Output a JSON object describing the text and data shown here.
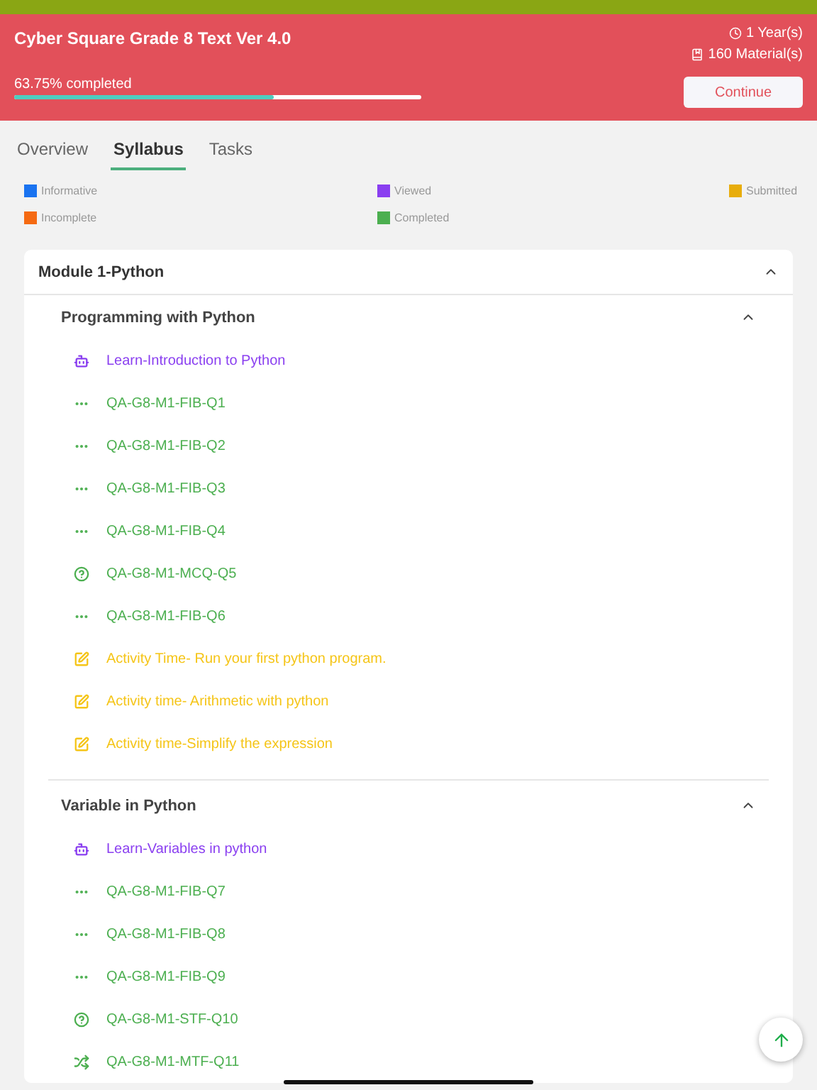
{
  "course": {
    "title": "Cyber Square Grade 8 Text Ver 4.0",
    "duration": "1 Year(s)",
    "materials": "160 Material(s)",
    "progress_text": "63.75% completed",
    "level": 0.6375,
    "continue_button": "Continue"
  },
  "tabs": [
    {
      "label": "Overview",
      "selected": false
    },
    {
      "label": "Syllabus",
      "selected": true
    },
    {
      "label": "Tasks",
      "selected": false
    }
  ],
  "legend": [
    {
      "label": "Informative",
      "color": "#1a73f0"
    },
    {
      "label": "Viewed",
      "color": "#8a3ff0"
    },
    {
      "label": "Submitted",
      "color": "#e8ad0c"
    },
    {
      "label": "Incomplete",
      "color": "#f56a12"
    },
    {
      "label": "Completed",
      "color": "#4caf50"
    }
  ],
  "module": {
    "title": "Module 1-Python",
    "expanded": true,
    "sections": [
      {
        "title": "Programming with Python",
        "expanded": true,
        "items": [
          {
            "kind": "learn",
            "label": "Learn-Introduction to Python",
            "color": "#8a3ff0"
          },
          {
            "kind": "fib",
            "label": "QA-G8-M1-FIB-Q1",
            "color": "#4caf50"
          },
          {
            "kind": "fib",
            "label": "QA-G8-M1-FIB-Q2",
            "color": "#4caf50"
          },
          {
            "kind": "fib",
            "label": "QA-G8-M1-FIB-Q3",
            "color": "#4caf50"
          },
          {
            "kind": "fib",
            "label": "QA-G8-M1-FIB-Q4",
            "color": "#4caf50"
          },
          {
            "kind": "question",
            "label": "QA-G8-M1-MCQ-Q5",
            "color": "#4caf50"
          },
          {
            "kind": "fib",
            "label": "QA-G8-M1-FIB-Q6",
            "color": "#4caf50"
          },
          {
            "kind": "activity",
            "label": "Activity Time- Run your first python program.",
            "color": "#f5c518"
          },
          {
            "kind": "activity",
            "label": "Activity time- Arithmetic with python",
            "color": "#f5c518"
          },
          {
            "kind": "activity",
            "label": "Activity time-Simplify the expression",
            "color": "#f5c518"
          }
        ]
      },
      {
        "title": "Variable in Python",
        "expanded": true,
        "items": [
          {
            "kind": "learn",
            "label": "Learn-Variables in python",
            "color": "#8a3ff0"
          },
          {
            "kind": "fib",
            "label": "QA-G8-M1-FIB-Q7",
            "color": "#4caf50"
          },
          {
            "kind": "fib",
            "label": "QA-G8-M1-FIB-Q8",
            "color": "#4caf50"
          },
          {
            "kind": "fib",
            "label": "QA-G8-M1-FIB-Q9",
            "color": "#4caf50"
          },
          {
            "kind": "question",
            "label": "QA-G8-M1-STF-Q10",
            "color": "#4caf50"
          },
          {
            "kind": "shuffle",
            "label": "QA-G8-M1-MTF-Q11",
            "color": "#4caf50"
          }
        ]
      }
    ]
  }
}
